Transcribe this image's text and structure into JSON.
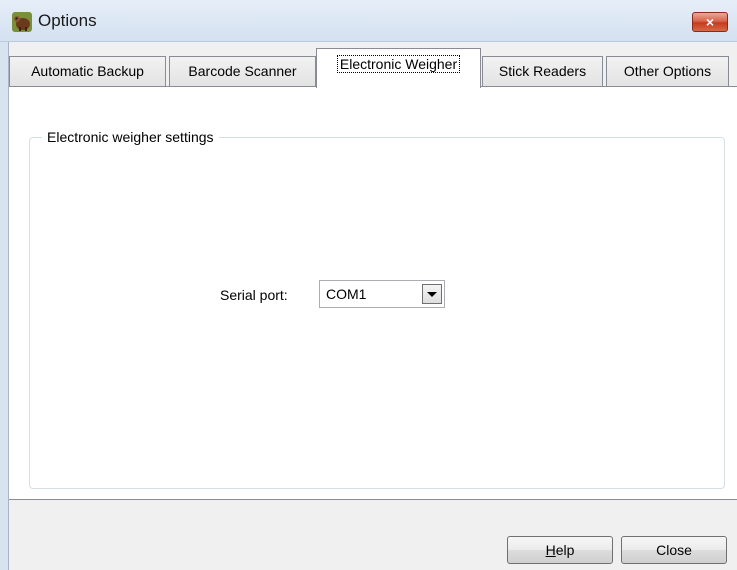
{
  "window": {
    "title": "Options",
    "close_glyph": "×",
    "icon": "app-icon"
  },
  "tabs": [
    {
      "label": "Automatic Backup",
      "active": false
    },
    {
      "label": "Barcode Scanner",
      "active": false
    },
    {
      "label": "Electronic Weigher",
      "active": true
    },
    {
      "label": "Stick Readers",
      "active": false
    },
    {
      "label": "Other Options",
      "active": false
    }
  ],
  "weigher": {
    "group_title": "Electronic weigher settings",
    "serial_port_label": "Serial port:",
    "serial_port_value": "COM1",
    "dropdown_icon": "chevron-down-icon"
  },
  "buttons": {
    "help_label": "Help",
    "help_mnemonic": "H",
    "close_label": "Close"
  },
  "colors": {
    "titlebar": "#dae6f4",
    "close_button": "#c9472b",
    "dialog_background": "#f0f0f0",
    "page_background": "#ffffff"
  }
}
